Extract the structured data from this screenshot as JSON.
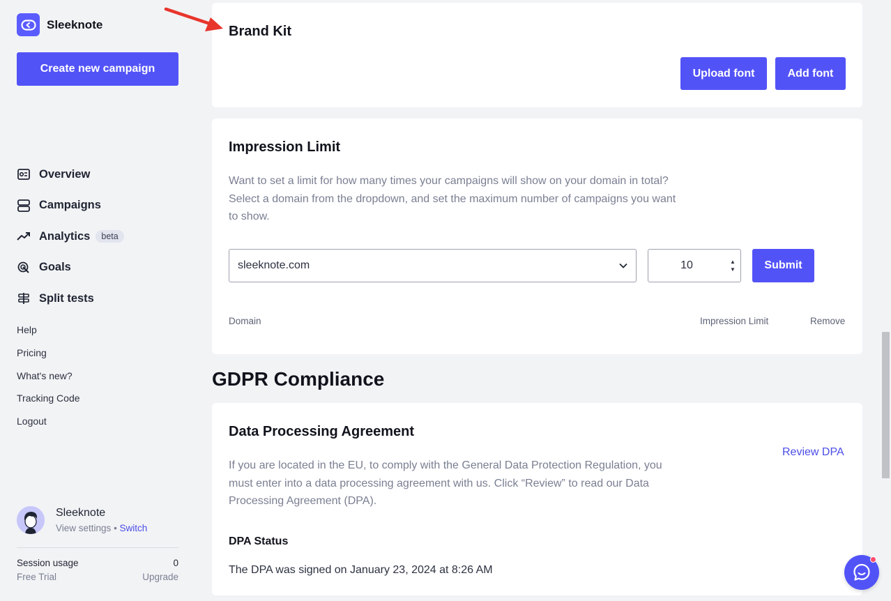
{
  "app": {
    "brand_name": "Sleeknote",
    "create_button": "Create new campaign",
    "accent_color": "#5253f7"
  },
  "nav": {
    "items": [
      {
        "label": "Overview",
        "icon": "overview-icon"
      },
      {
        "label": "Campaigns",
        "icon": "campaigns-icon"
      },
      {
        "label": "Analytics",
        "icon": "analytics-icon",
        "badge": "beta"
      },
      {
        "label": "Goals",
        "icon": "goals-icon"
      },
      {
        "label": "Split tests",
        "icon": "split-tests-icon"
      }
    ],
    "links": [
      "Help",
      "Pricing",
      "What's new?",
      "Tracking Code",
      "Logout"
    ]
  },
  "profile": {
    "name": "Sleeknote",
    "view_settings": "View settings",
    "switch": "Switch"
  },
  "session": {
    "label": "Session usage",
    "value": "0",
    "plan": "Free Trial",
    "upgrade": "Upgrade"
  },
  "brand_kit": {
    "title": "Brand Kit",
    "upload_font": "Upload font",
    "add_font": "Add font"
  },
  "impression_limit": {
    "title": "Impression Limit",
    "description": "Want to set a limit for how many times your campaigns will show on your domain in total? Select a domain from the dropdown, and set the maximum number of campaigns you want to show.",
    "domain_selected": "sleeknote.com",
    "limit_value": "10",
    "submit": "Submit",
    "columns": [
      "Domain",
      "Impression Limit",
      "Remove"
    ]
  },
  "gdpr": {
    "section_title": "GDPR Compliance",
    "dpa_title": "Data Processing Agreement",
    "description": "If you are located in the EU, to comply with the General Data Protection Regulation, you must enter into a data processing agreement with us. Click “Review” to read our Data Processing Agreement (DPA).",
    "review_link": "Review DPA",
    "status_title": "DPA Status",
    "status_text": "The DPA was signed on January 23, 2024 at 8:26 AM"
  }
}
